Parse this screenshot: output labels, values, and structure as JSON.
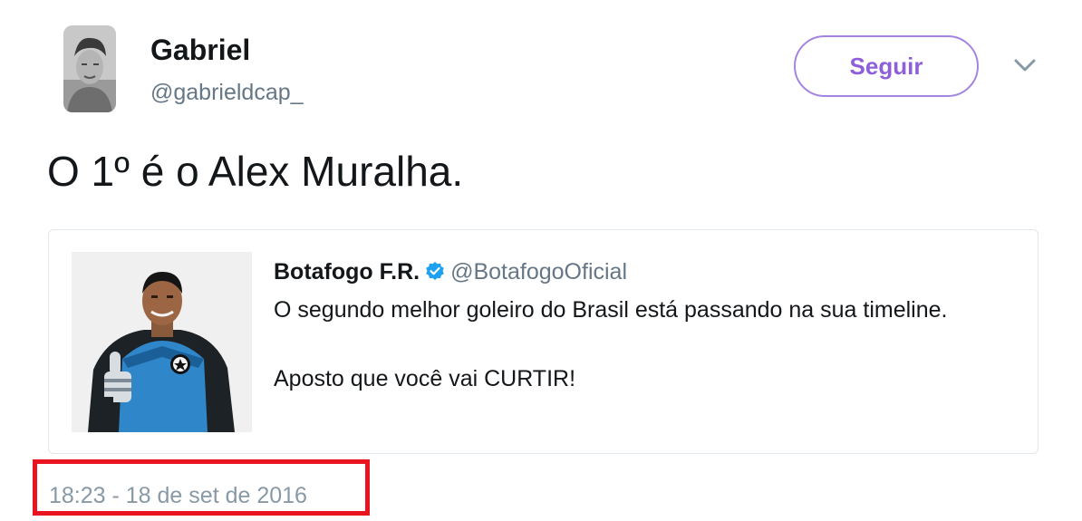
{
  "author": {
    "display_name": "Gabriel",
    "handle": "@gabrieldcap_",
    "avatar_icon": "profile-photo"
  },
  "follow_button": {
    "label": "Seguir",
    "accent_color": "#8e5fdb"
  },
  "menu": {
    "icon": "chevron-down-icon"
  },
  "tweet": {
    "text": "O 1º é o Alex Muralha."
  },
  "quoted_tweet": {
    "author_name": "Botafogo F.R.",
    "verified_icon": "verified-badge-icon",
    "author_handle": "@BotafogoOficial",
    "line_1": "O segundo melhor goleiro do Brasil está passando na sua timeline.",
    "line_2": "Aposto que você vai CURTIR!",
    "media": "goalkeeper-photo"
  },
  "timestamp": {
    "text": "18:23 - 18 de set de 2016",
    "highlight_color": "#e8141f"
  }
}
